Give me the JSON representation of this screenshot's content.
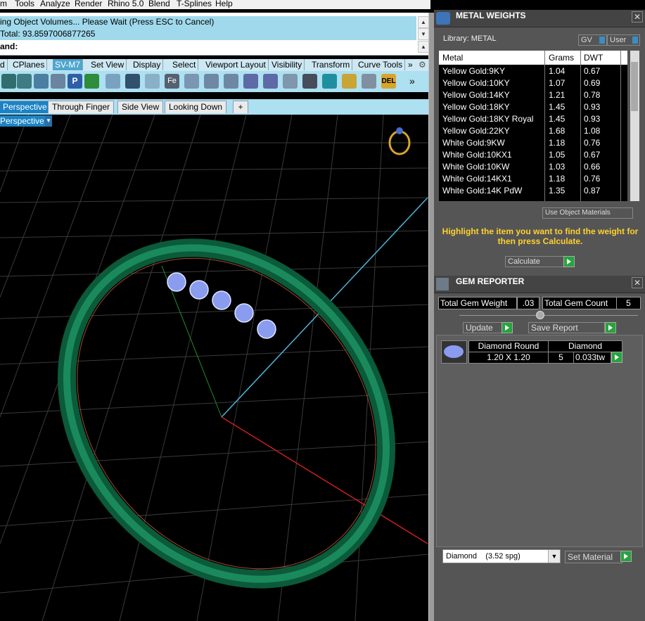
{
  "menu": [
    "m",
    "Tools",
    "Analyze",
    "Render",
    "Rhino 5.0",
    "Blend",
    "T-Splines",
    "Help"
  ],
  "command": {
    "line1": "ing Object Volumes... Please Wait (Press ESC to Cancel)",
    "line2": " Total: 93.8597006877265",
    "line3": "and:"
  },
  "toolbar_tabs": [
    "d",
    "CPlanes",
    "SV-M7",
    "Set View",
    "Display",
    "Select",
    "Viewport Layout",
    "Visibility",
    "Transform",
    "Curve Tools"
  ],
  "toolbar_overflow": "»",
  "icon_overflow": "»",
  "viewport_tabs": [
    "Perspective",
    "Through Finger",
    "Side View",
    "Looking Down"
  ],
  "viewport_add": "+",
  "viewport_name": "Perspective",
  "metal_weights": {
    "title": "METAL WEIGHTS",
    "library_label": "Library: METAL",
    "gv": "GV",
    "user": "User",
    "headers": [
      "Metal",
      "Grams",
      "DWT"
    ],
    "rows": [
      [
        "Yellow Gold:9KY",
        "1.04",
        "0.67"
      ],
      [
        "Yellow Gold:10KY",
        "1.07",
        "0.69"
      ],
      [
        "Yellow Gold:14KY",
        "1.21",
        "0.78"
      ],
      [
        "Yellow Gold:18KY",
        "1.45",
        "0.93"
      ],
      [
        "Yellow Gold:18KY Royal",
        "1.45",
        "0.93"
      ],
      [
        "Yellow Gold:22KY",
        "1.68",
        "1.08"
      ],
      [
        "White Gold:9KW",
        "1.18",
        "0.76"
      ],
      [
        "White Gold:10KX1",
        "1.05",
        "0.67"
      ],
      [
        "White Gold:10KW",
        "1.03",
        "0.66"
      ],
      [
        "White Gold:14KX1",
        "1.18",
        "0.76"
      ],
      [
        "White Gold:14K PdW",
        "1.35",
        "0.87"
      ]
    ],
    "use_object_materials": "Use Object Materials",
    "instructions": "Highlight the item you want to find the weight for then press Calculate.",
    "calculate": "Calculate"
  },
  "gem_reporter": {
    "title": "GEM REPORTER",
    "total_weight_label": "Total Gem Weight",
    "total_weight_value": ".03",
    "total_count_label": "Total Gem Count",
    "total_count_value": "5",
    "update": "Update",
    "save_report": "Save Report",
    "gem_row": {
      "shape_header": "Diamond Round",
      "material_header": "Diamond",
      "size": "1.20 X 1.20",
      "count": "5",
      "weight": "0.033tw"
    },
    "material_select": "Diamond    (3.52 spg)",
    "set_material": "Set Material"
  },
  "colors": {
    "ring": "#0e6a47",
    "gem": "#8a9cf0",
    "panel": "#555555",
    "highlight": "#ffd22e"
  }
}
